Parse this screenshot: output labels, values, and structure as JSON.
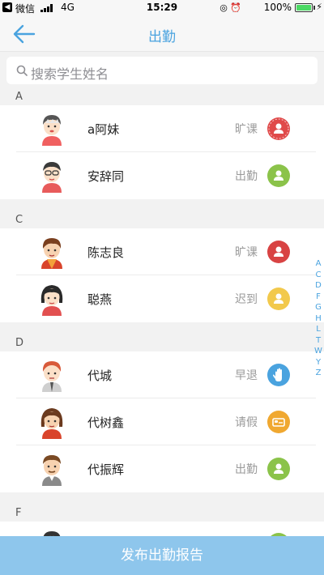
{
  "status_bar": {
    "back_app": "◀",
    "carrier": "微信",
    "network": "4G",
    "time": "15:29",
    "icons": "◎ ⏰",
    "battery_pct": "100%",
    "battery_level": 1.0
  },
  "nav": {
    "title": "出勤",
    "back_icon": "back-arrow-icon"
  },
  "search": {
    "placeholder": "搜索学生姓名"
  },
  "sections": [
    {
      "letter": "A",
      "students": [
        {
          "name": "a阿妹",
          "status": "旷课",
          "status_icon": "user-icon",
          "status_color": "#e04a4a"
        },
        {
          "name": "安辞同",
          "status": "出勤",
          "status_icon": "user-icon",
          "status_color": "#8bc34a"
        }
      ]
    },
    {
      "letter": "C",
      "students": [
        {
          "name": "陈志良",
          "status": "旷课",
          "status_icon": "user-icon",
          "status_color": "#d84343"
        },
        {
          "name": "聪燕",
          "status": "迟到",
          "status_icon": "user-icon",
          "status_color": "#f2c94c"
        }
      ]
    },
    {
      "letter": "D",
      "students": [
        {
          "name": "代城",
          "status": "早退",
          "status_icon": "hand-icon",
          "status_color": "#4aa3df"
        },
        {
          "name": "代树鑫",
          "status": "请假",
          "status_icon": "bed-icon",
          "status_color": "#f0a830"
        },
        {
          "name": "代振辉",
          "status": "出勤",
          "status_icon": "user-icon",
          "status_color": "#8bc34a"
        }
      ]
    },
    {
      "letter": "F",
      "students": []
    }
  ],
  "alpha_index": [
    "A",
    "C",
    "D",
    "F",
    "G",
    "H",
    "L",
    "T",
    "W",
    "Y",
    "Z"
  ],
  "footer": {
    "button_label": "发布出勤报告"
  },
  "colors": {
    "accent": "#4aa3df",
    "footer": "#8ec6ec"
  }
}
